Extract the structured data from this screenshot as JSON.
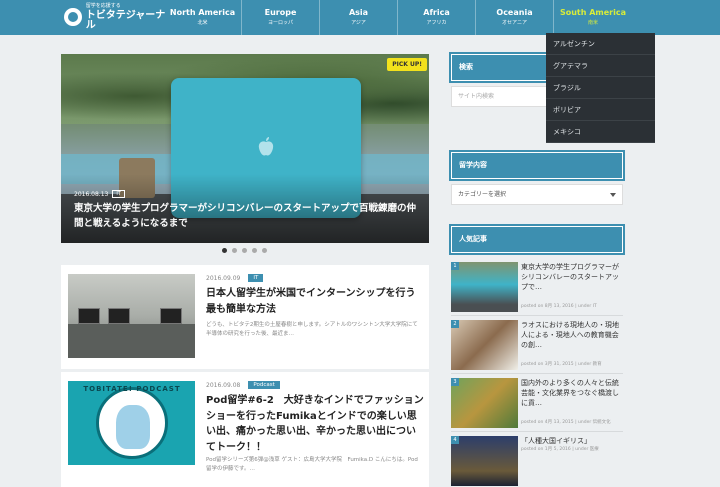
{
  "site": {
    "logo_small": "留学を応援する",
    "logo_big": "トビタテジャーナル"
  },
  "nav": [
    {
      "en": "North America",
      "ja": "北米",
      "active": false
    },
    {
      "en": "Europe",
      "ja": "ヨーロッパ",
      "active": false
    },
    {
      "en": "Asia",
      "ja": "アジア",
      "active": false
    },
    {
      "en": "Africa",
      "ja": "アフリカ",
      "active": false
    },
    {
      "en": "Oceania",
      "ja": "オセアニア",
      "active": false
    },
    {
      "en": "South America",
      "ja": "南米",
      "active": true
    }
  ],
  "dropdown": [
    "アルゼンチン",
    "グアテマラ",
    "ブラジル",
    "ボリビア",
    "メキシコ"
  ],
  "hero": {
    "badge": "PICK UP!",
    "date": "2016.08.13",
    "category": "IT",
    "title": "東京大学の学生プログラマーがシリコンバレーのスタートアップで百戦錬磨の仲間と戦えるようになるまで",
    "slides": 5,
    "active_slide": 1
  },
  "articles": [
    {
      "date": "2016.09.09",
      "category": "IT",
      "title": "日本人留学生が米国でインターンシップを行う最も簡単な方法",
      "excerpt": "どうも、トビタテ2期生の土屋春樹と申します。シアトルのワシントン大学大学院にて半導体の研究を行った後、最近ま…"
    },
    {
      "date": "2016.09.08",
      "category": "Podcast",
      "title": "Pod留学#6-2　大好きなインドでファッションショーを行ったFumikaとインドでの楽しい思い出、痛かった思い出、辛かった思い出についてトーク！！",
      "excerpt": "Pod留学シリーズ第6弾@浅草 ゲスト：広島大学大学院　Fumika.D こんにちは。Pod留学の伊藤です。…",
      "thumb_text": "TOBITATE! PODCAST"
    }
  ],
  "sidebar": {
    "search_title": "検索",
    "search_placeholder": "サイト内検索",
    "category_title": "留学内容",
    "category_select": "カテゴリーを選択",
    "popular_title": "人気記事",
    "popular": [
      {
        "num": "1",
        "title": "東京大学の学生プログラマーがシリコンバレーのスタートアップで…",
        "meta": "posted on 8月 13, 2016 | under IT"
      },
      {
        "num": "2",
        "title": "ラオスにおける現地人の・現地人による・現地人への教育機会の創…",
        "meta": "posted on 3月 31, 2015 | under 教育"
      },
      {
        "num": "3",
        "title": "国内外のより多くの人々と伝統芸能・文化業界をつなぐ橋渡しに貢…",
        "meta": "posted on 4月 13, 2015 | under 伝統文化"
      },
      {
        "num": "4",
        "title": "「人種大国イギリス」",
        "meta": "posted on 1月 5, 2016 | under 医療"
      }
    ]
  },
  "colors": {
    "header": "#3d8fb0",
    "accent_active": "#d8ec3a",
    "pickup": "#f2e11c",
    "dropdown_bg": "#2b3035"
  }
}
